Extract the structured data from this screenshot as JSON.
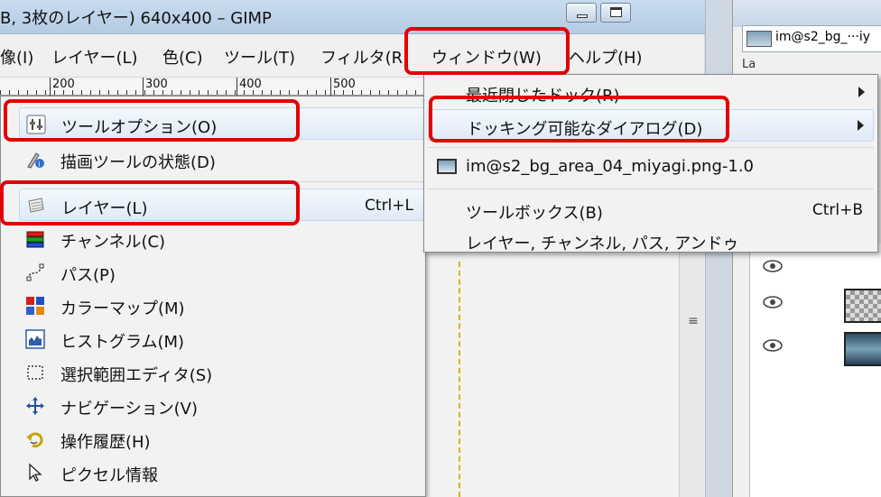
{
  "window": {
    "title": "B, 3枚のレイヤー) 640x400 – GIMP"
  },
  "menubar": {
    "items": [
      "像(I)",
      "レイヤー(L)",
      "色(C)",
      "ツール(T)",
      "フィルタ(R)",
      "ウィンドウ(W)",
      "ヘルプ(H)"
    ]
  },
  "ruler": {
    "labels": [
      "200",
      "300",
      "400",
      "500"
    ]
  },
  "dialogs_menu": {
    "items": [
      {
        "label": "ツールオプション(O)",
        "accel": "",
        "icon": "tool-options-icon"
      },
      {
        "label": "描画ツールの状態(D)",
        "accel": "",
        "icon": "paint-dynamics-icon"
      },
      {
        "label": "レイヤー(L)",
        "accel": "Ctrl+L",
        "icon": "layers-icon"
      },
      {
        "label": "チャンネル(C)",
        "accel": "",
        "icon": "channels-icon"
      },
      {
        "label": "パス(P)",
        "accel": "",
        "icon": "paths-icon"
      },
      {
        "label": "カラーマップ(M)",
        "accel": "",
        "icon": "colormap-icon"
      },
      {
        "label": "ヒストグラム(M)",
        "accel": "",
        "icon": "histogram-icon"
      },
      {
        "label": "選択範囲エディタ(S)",
        "accel": "",
        "icon": "selection-editor-icon"
      },
      {
        "label": "ナビゲーション(V)",
        "accel": "",
        "icon": "navigation-icon"
      },
      {
        "label": "操作履歴(H)",
        "accel": "",
        "icon": "undo-history-icon"
      },
      {
        "label": "ピクセル情報",
        "accel": "",
        "icon": "pointer-icon"
      }
    ]
  },
  "window_menu": {
    "items": [
      {
        "label": "最近閉じたドック(R)",
        "accel": "",
        "submenu": true
      },
      {
        "label": "ドッキング可能なダイアログ(D)",
        "accel": "",
        "submenu": true
      },
      {
        "label": "im@s2_bg_area_04_miyagi.png-1.0",
        "accel": "",
        "submenu": false
      },
      {
        "label": "ツールボックス(B)",
        "accel": "Ctrl+B",
        "submenu": false
      },
      {
        "label": "レイヤー, チャンネル, パス, アンドゥ",
        "accel": "",
        "submenu": false
      }
    ]
  },
  "right_panel": {
    "image_tab": "im@s2_bg_···iy",
    "tab_fragment": "La"
  },
  "colors": {
    "highlight_red": "#e30000",
    "menu_bg": "#f2f2f2",
    "menu_hover": "#dfeaf7"
  }
}
